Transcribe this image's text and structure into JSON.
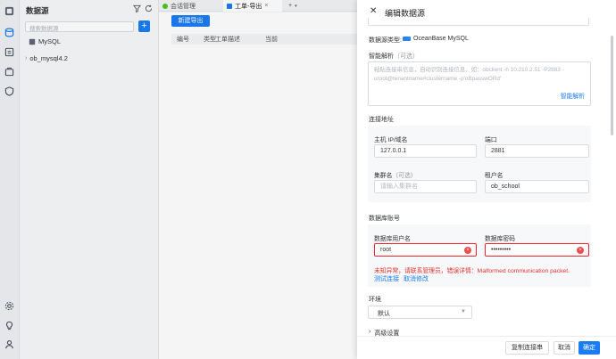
{
  "sidebar": {
    "title": "数据源",
    "search_placeholder": "搜索数据源",
    "add_label": "+",
    "items": [
      {
        "label": "MySQL"
      },
      {
        "label": "ob_mysql4.2"
      }
    ]
  },
  "tabs": [
    {
      "label": "会话管理"
    },
    {
      "label": "工单-导出"
    },
    {
      "label": "+"
    }
  ],
  "main": {
    "new_export_button": "新建导出",
    "columns": [
      "编号",
      "类型",
      "工单描述",
      "当前"
    ]
  },
  "drawer": {
    "title": "编辑数据源",
    "datasource_type_label": "数据源类型:",
    "datasource_type_value": "OceanBase MySQL",
    "smart_parse_label": "智能解析",
    "smart_parse_optional": "（可选）",
    "smart_parse_placeholder": "粘贴连接串信息，自动识别连接信息，如：obclient -h 10.210.2.51 -P2883 -uroot@tenantname#clustername -p'oBpasswORd'",
    "smart_parse_button": "智能解析",
    "connection_section": "连接地址",
    "host_label": "主机 IP/域名",
    "host_value": "127.0.0.1",
    "port_label": "端口",
    "port_value": "2881",
    "cluster_label": "集群名",
    "cluster_optional": "（可选）",
    "cluster_placeholder": "请输入集群名",
    "tenant_label": "租户名",
    "tenant_value": "ob_school",
    "account_section": "数据库账号",
    "username_label": "数据库用户名",
    "username_value": "root",
    "password_label": "数据库密码",
    "password_value": "•••••••••",
    "error_message": "未知异常，请联系管理员，错误详情：Malformed communication packet.",
    "test_connection": "测试连接",
    "cancel_edit": "取消修改",
    "environment_label": "环境",
    "environment_value": "默认",
    "advanced_label": "高级设置",
    "copy_conn_button": "复制连接串",
    "cancel_button": "取消",
    "confirm_button": "确定"
  },
  "colors": {
    "primary": "#1a7cf3",
    "error": "#f5222d"
  }
}
